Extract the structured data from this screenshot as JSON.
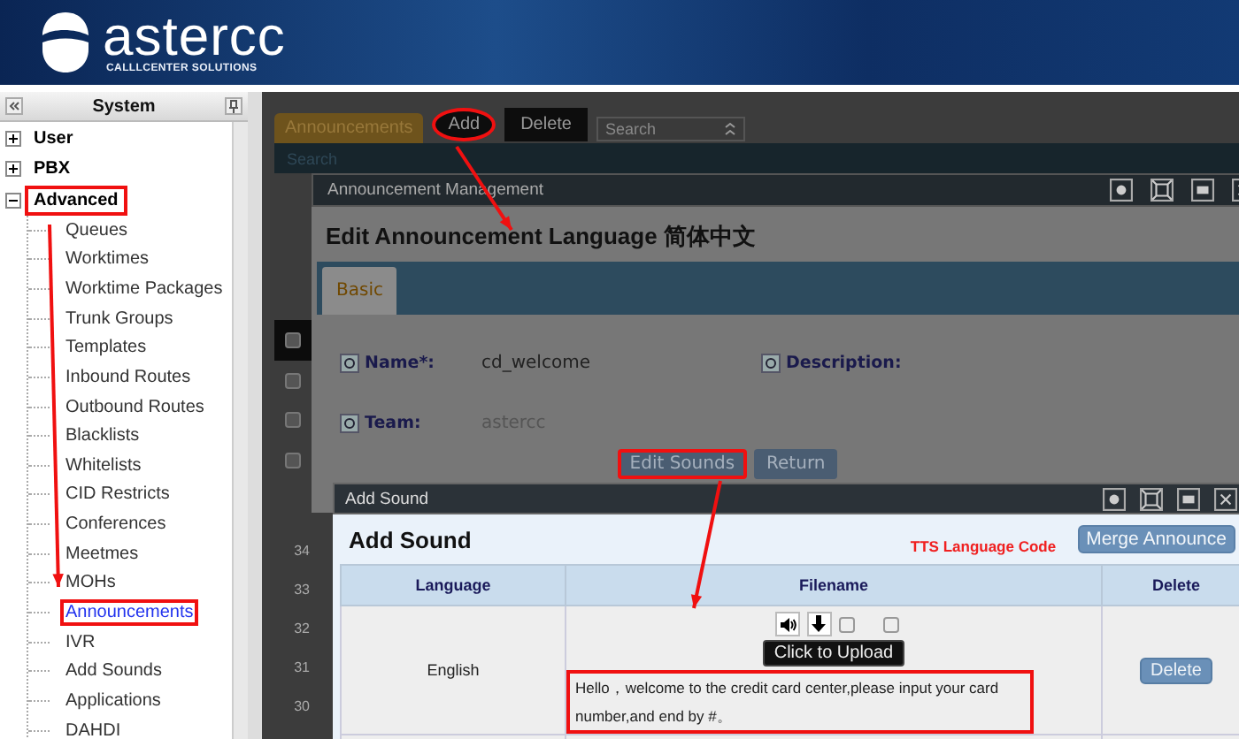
{
  "header": {
    "logo_text": "astercc",
    "tagline": "CALLLCENTER SOLUTIONS"
  },
  "sidebar": {
    "title": "System",
    "items": [
      {
        "label": "User",
        "expanded": false,
        "annotated": false
      },
      {
        "label": "PBX",
        "expanded": false,
        "annotated": false
      },
      {
        "label": "Advanced",
        "expanded": true,
        "annotated": true,
        "children": [
          {
            "label": "Queues",
            "selected": false,
            "annotated": false
          },
          {
            "label": "Worktimes",
            "selected": false,
            "annotated": false
          },
          {
            "label": "Worktime Packages",
            "selected": false,
            "annotated": false
          },
          {
            "label": "Trunk Groups",
            "selected": false,
            "annotated": false
          },
          {
            "label": "Templates",
            "selected": false,
            "annotated": false
          },
          {
            "label": "Inbound Routes",
            "selected": false,
            "annotated": false
          },
          {
            "label": "Outbound Routes",
            "selected": false,
            "annotated": false
          },
          {
            "label": "Blacklists",
            "selected": false,
            "annotated": false
          },
          {
            "label": "Whitelists",
            "selected": false,
            "annotated": false
          },
          {
            "label": "CID Restricts",
            "selected": false,
            "annotated": false
          },
          {
            "label": "Conferences",
            "selected": false,
            "annotated": false
          },
          {
            "label": "Meetmes",
            "selected": false,
            "annotated": false
          },
          {
            "label": "MOHs",
            "selected": false,
            "annotated": false
          },
          {
            "label": "Announcements",
            "selected": true,
            "annotated": true
          },
          {
            "label": "IVR",
            "selected": false,
            "annotated": false
          },
          {
            "label": "Add Sounds",
            "selected": false,
            "annotated": false
          },
          {
            "label": "Applications",
            "selected": false,
            "annotated": false
          },
          {
            "label": "DAHDI",
            "selected": false,
            "annotated": false
          }
        ]
      }
    ]
  },
  "toolbar": {
    "tab": "Announcements",
    "buttons": [
      {
        "label": "Add",
        "annotated": true
      },
      {
        "label": "Delete",
        "annotated": false
      }
    ],
    "search_select": "Search"
  },
  "search_bar": {
    "label": "Search"
  },
  "list": {
    "checkboxes": [
      {
        "checked": false
      },
      {
        "checked": false
      },
      {
        "checked": false
      },
      {
        "checked": false
      }
    ],
    "row_numbers": [
      "34",
      "33",
      "32",
      "31",
      "30"
    ]
  },
  "edit_dialog": {
    "title": "Announcement Management",
    "heading": "Edit Announcement Language 简体中文",
    "tabs": [
      {
        "label": "Basic",
        "selected": true
      }
    ],
    "fields": [
      {
        "label": "Name*:",
        "value": "cd_welcome"
      },
      {
        "label": "Description:"
      },
      {
        "label": "Team:",
        "value": "astercc"
      }
    ],
    "buttons": [
      {
        "label": "Edit Sounds",
        "annotated": true
      },
      {
        "label": "Return",
        "annotated": false
      }
    ]
  },
  "sound_dialog": {
    "title": "Add Sound",
    "heading": "Add Sound",
    "tts_label": "TTS Language Code",
    "merge_button": "Merge Announce",
    "columns": [
      "Language",
      "Filename",
      "Delete"
    ],
    "rows": [
      {
        "language": "English",
        "options": [
          {
            "checked": false
          },
          {
            "checked": false
          }
        ],
        "upload_button": "Click to Upload",
        "text": "Hello，welcome to the credit card center,please input your card number,and end by #。",
        "annotated": true,
        "delete_button": "Delete"
      }
    ]
  }
}
